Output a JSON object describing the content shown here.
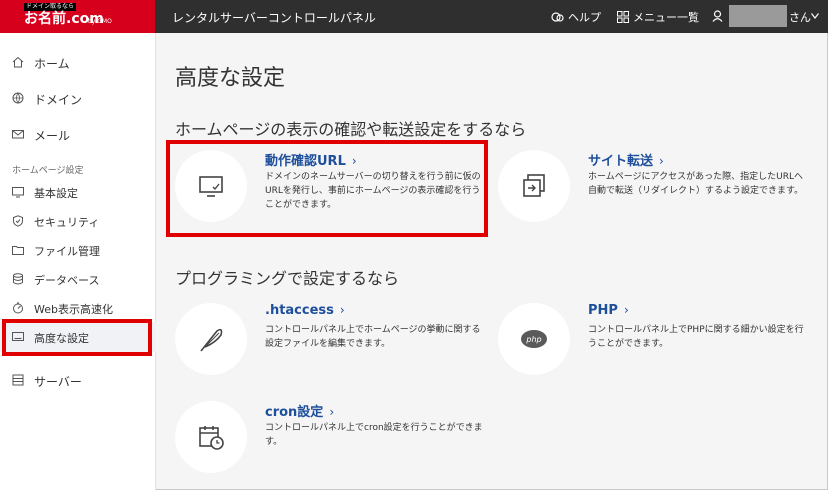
{
  "header": {
    "logo_tag": "ドメイン取るなら",
    "logo_brand": "お名前.com",
    "logo_sub": "by GMO",
    "title": "レンタルサーバーコントロールパネル",
    "help_label": "ヘルプ",
    "menu_label": "メニュー一覧",
    "user_suffix": "さん"
  },
  "sidebar": {
    "items": [
      {
        "label": "ホーム",
        "icon": "home-icon"
      },
      {
        "label": "ドメイン",
        "icon": "globe-icon"
      },
      {
        "label": "メール",
        "icon": "mail-icon"
      }
    ],
    "section_label": "ホームページ設定",
    "sub_items": [
      {
        "label": "基本設定",
        "icon": "monitor-icon"
      },
      {
        "label": "セキュリティ",
        "icon": "shield-icon"
      },
      {
        "label": "ファイル管理",
        "icon": "folder-icon"
      },
      {
        "label": "データベース",
        "icon": "database-icon"
      },
      {
        "label": "Web表示高速化",
        "icon": "speed-icon"
      },
      {
        "label": "高度な設定",
        "icon": "advanced-icon"
      }
    ],
    "server_label": "サーバー"
  },
  "main": {
    "page_title": "高度な設定",
    "section1_title": "ホームページの表示の確認や転送設定をするなら",
    "section2_title": "プログラミングで設定するなら",
    "cards": [
      {
        "title": "動作確認URL",
        "chevron": "›",
        "desc": "ドメインのネームサーバーの切り替えを行う前に仮のURLを発行し、事前にホームページの表示確認を行うことができます。",
        "icon": "monitor-check-icon"
      },
      {
        "title": "サイト転送",
        "chevron": "›",
        "desc": "ホームページにアクセスがあった際、指定したURLへ自動で転送（リダイレクト）するよう設定できます。",
        "icon": "redirect-icon"
      },
      {
        "title": ".htaccess",
        "chevron": "›",
        "desc": "コントロールパネル上でホームページの挙動に関する設定ファイルを編集できます。",
        "icon": "feather-icon"
      },
      {
        "title": "PHP",
        "chevron": "›",
        "desc": "コントロールパネル上でPHPに関する細かい設定を行うことができます。",
        "icon": "php-icon",
        "badge": "php"
      },
      {
        "title": "cron設定",
        "chevron": "›",
        "desc": "コントロールパネル上でcron設定を行うことができます。",
        "icon": "calendar-clock-icon"
      }
    ]
  },
  "colors": {
    "header_bg": "#2f2f2f",
    "logo_red": "#d6001c",
    "link_blue": "#1e4f9b",
    "highlight_red": "#e00000"
  }
}
